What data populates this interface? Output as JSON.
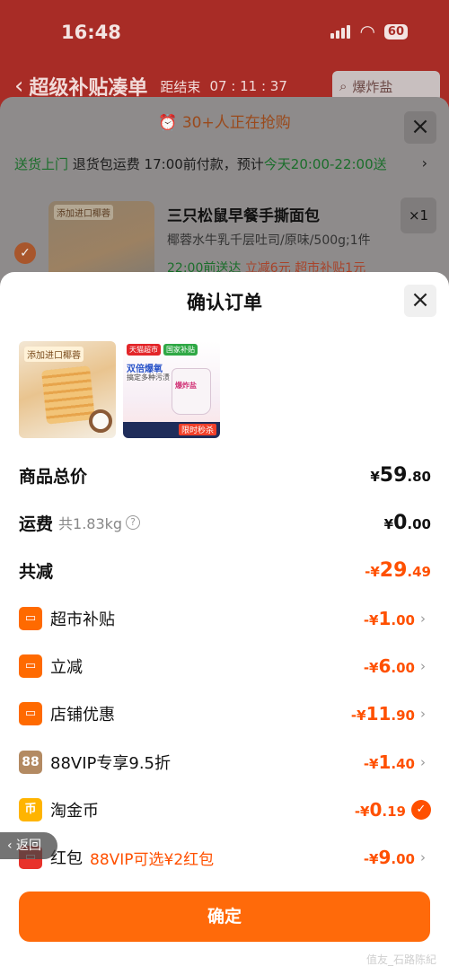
{
  "status_bar": {
    "time": "16:48",
    "battery": "60"
  },
  "background_page": {
    "title": "超级补贴凑单",
    "countdown_label": "距结束",
    "countdown": "07 : 11 : 37",
    "search_placeholder": "爆炸盐",
    "urgency": "⏰ 30+人正在抢购",
    "delivery_green": "送货上门",
    "delivery_text": " 退货包运费 17:00前付款，预计",
    "delivery_time": "今天20:00-22:00送",
    "item": {
      "image_tag": "添加进口椰蓉",
      "title": "三只松鼠早餐手撕面包",
      "spec": "椰蓉水牛乳千层吐司/原味/500g;1件",
      "tag_delivery": "22:00前送达",
      "tag_discount": "立减6元",
      "tag_subsidy": "超市补贴1元",
      "qty": "×1"
    }
  },
  "order_sheet": {
    "title": "确认订单",
    "thumbs": {
      "bread_tag": "添加进口椰蓉",
      "bleach_tag1": "天猫超市",
      "bleach_tag2": "国家补贴",
      "bleach_headline": "双倍爆氧",
      "bleach_subline": "搞定多种污渍",
      "bleach_jar": "爆炸盐",
      "bleach_badge": "限时秒杀"
    },
    "summary": {
      "total_label": "商品总价",
      "total": {
        "cur": "¥",
        "int": "59",
        "dec": ".80"
      },
      "shipping_label": "运费",
      "shipping_weight": "共1.83kg",
      "shipping": {
        "cur": "¥",
        "int": "0",
        "dec": ".00"
      },
      "reduce_label": "共减",
      "reduce": {
        "cur": "-¥",
        "int": "29",
        "dec": ".49"
      }
    },
    "discounts": [
      {
        "icon": "▭",
        "label": "超市补贴",
        "note": "",
        "cur": "-¥",
        "int": "1",
        "dec": ".00"
      },
      {
        "icon": "▭",
        "label": "立减",
        "note": "",
        "cur": "-¥",
        "int": "6",
        "dec": ".00"
      },
      {
        "icon": "▭",
        "label": "店铺优惠",
        "note": "",
        "cur": "-¥",
        "int": "11",
        "dec": ".90"
      },
      {
        "icon": "88",
        "label": "88VIP专享9.5折",
        "note": "",
        "cur": "-¥",
        "int": "1",
        "dec": ".40"
      },
      {
        "icon": "币",
        "label": "淘金币",
        "note": "",
        "cur": "-¥",
        "int": "0",
        "dec": ".19"
      },
      {
        "icon": "▭",
        "label": "红包",
        "note": "88VIP可选¥2红包",
        "cur": "-¥",
        "int": "9",
        "dec": ".00"
      }
    ],
    "confirm_label": "确定"
  },
  "floating_back": "‹ 返回",
  "watermark": "值友_石路陈紀",
  "colors": {
    "accent": "#ff5000",
    "button": "#ff6a0a"
  }
}
